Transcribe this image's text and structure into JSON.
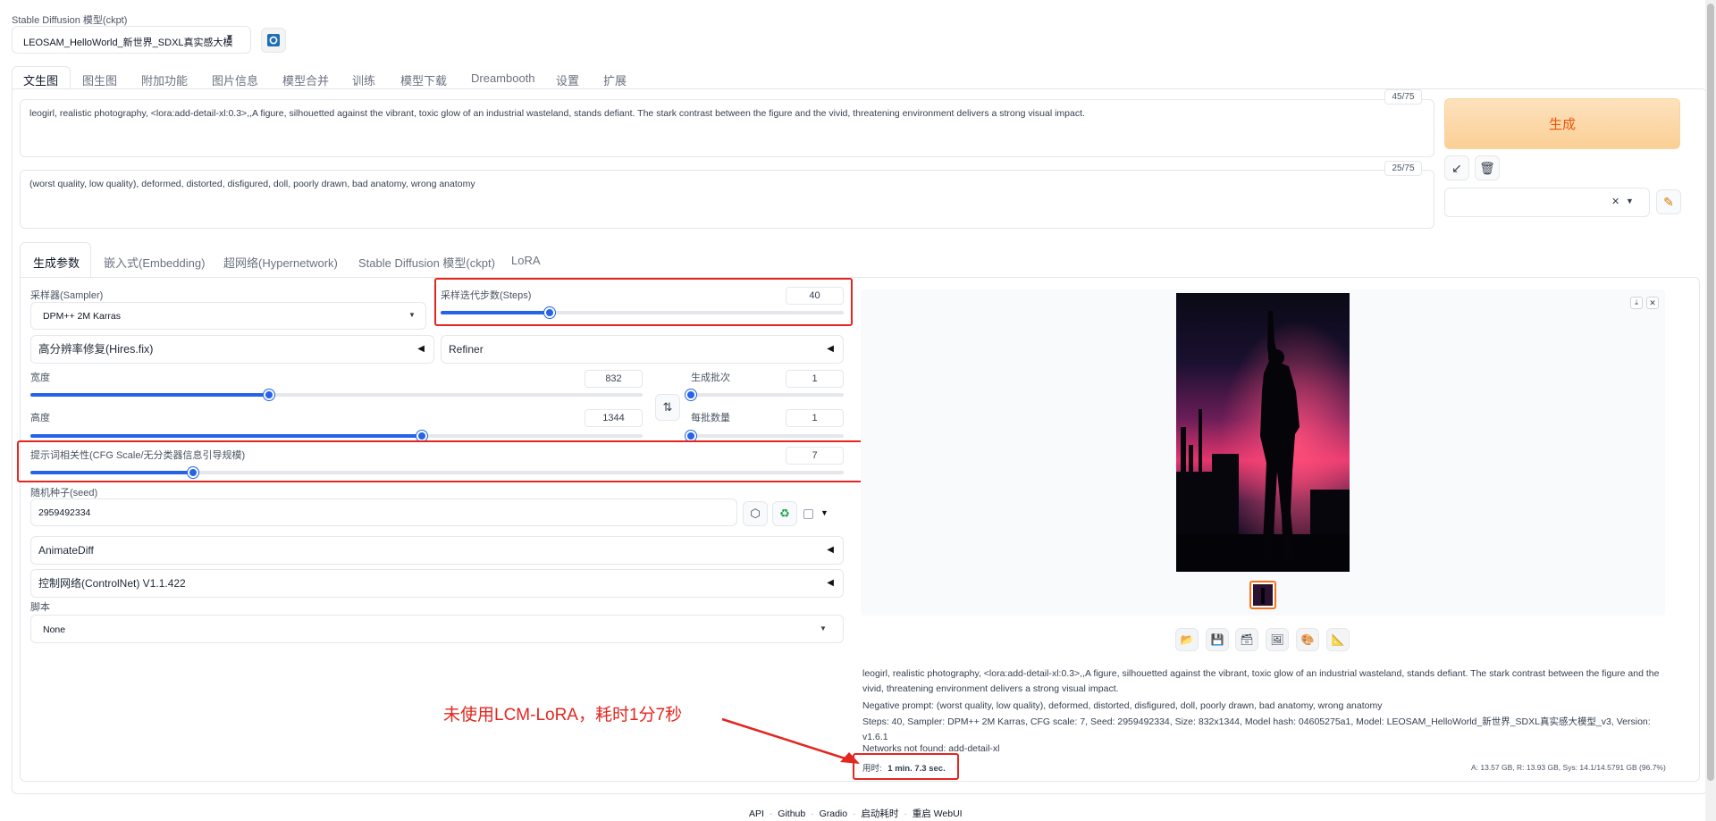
{
  "model_label": "Stable Diffusion 模型(ckpt)",
  "model_value": "LEOSAM_HelloWorld_新世界_SDXL真实感大模",
  "tabs": [
    "文生图",
    "图生图",
    "附加功能",
    "图片信息",
    "模型合并",
    "训练",
    "模型下载",
    "Dreambooth",
    "设置",
    "扩展"
  ],
  "prompt": {
    "text": "leogirl, realistic photography, <lora:add-detail-xl:0.3>,,A figure, silhouetted against the vibrant, toxic glow of an industrial wasteland, stands defiant. The stark contrast between the figure and the vivid, threatening environment delivers a strong visual impact.",
    "counter": "45/75"
  },
  "negative": {
    "text": "(worst quality, low quality), deformed, distorted, disfigured, doll, poorly drawn, bad anatomy, wrong anatomy",
    "counter": "25/75"
  },
  "generate_label": "生成",
  "subtabs": [
    "生成参数",
    "嵌入式(Embedding)",
    "超网络(Hypernetwork)",
    "Stable Diffusion 模型(ckpt)",
    "LoRA"
  ],
  "sampler": {
    "label": "采样器(Sampler)",
    "value": "DPM++ 2M Karras"
  },
  "steps": {
    "label": "采样迭代步数(Steps)",
    "value": "40",
    "fraction": 0.27
  },
  "hires_label": "高分辨率修复(Hires.fix)",
  "refiner_label": "Refiner",
  "width": {
    "label": "宽度",
    "value": "832",
    "fraction": 0.39
  },
  "height": {
    "label": "高度",
    "value": "1344",
    "fraction": 0.64
  },
  "batch_count": {
    "label": "生成批次",
    "value": "1",
    "fraction": 0.0
  },
  "batch_size": {
    "label": "每批数量",
    "value": "1",
    "fraction": 0.0
  },
  "cfg": {
    "label": "提示词相关性(CFG Scale/无分类器信息引导规模)",
    "value": "7",
    "fraction": 0.2
  },
  "seed": {
    "label": "随机种子(seed)",
    "value": "2959492334"
  },
  "animatediff_label": "AnimateDiff",
  "controlnet_label": "控制网络(ControlNet) V1.1.422",
  "script": {
    "label": "脚本",
    "value": "None"
  },
  "output": {
    "prompt_line": "leogirl, realistic photography, <lora:add-detail-xl:0.3>,,A figure, silhouetted against the vibrant, toxic glow of an industrial wasteland, stands defiant. The stark contrast between the figure and the vivid, threatening environment delivers a strong visual impact.",
    "negative_line": "Negative prompt: (worst quality, low quality), deformed, distorted, disfigured, doll, poorly drawn, bad anatomy, wrong anatomy",
    "params_line": "Steps: 40, Sampler: DPM++ 2M Karras, CFG scale: 7, Seed: 2959492334, Size: 832x1344, Model hash: 04605275a1, Model: LEOSAM_HelloWorld_新世界_SDXL真实感大模型_v3, Version: v1.6.1",
    "networks_line": "Networks not found: add-detail-xl",
    "time_label": "用时:",
    "time_value": "1 min. 7.3 sec.",
    "vram": "A: 13.57 GB, R: 13.93 GB, Sys: 14.1/14.5791 GB (96.7%)"
  },
  "annotation": "未使用LCM-LoRA，耗时1分7秒",
  "footer": {
    "api": "API",
    "github": "Github",
    "gradio": "Gradio",
    "startup": "启动耗时",
    "reload": "重启 WebUI",
    "sep": "·"
  },
  "colors": {
    "accent": "#2563eb",
    "generate_bg": "#fdd9a8",
    "generate_text": "#ea580c",
    "annotation": "#e3261f"
  }
}
